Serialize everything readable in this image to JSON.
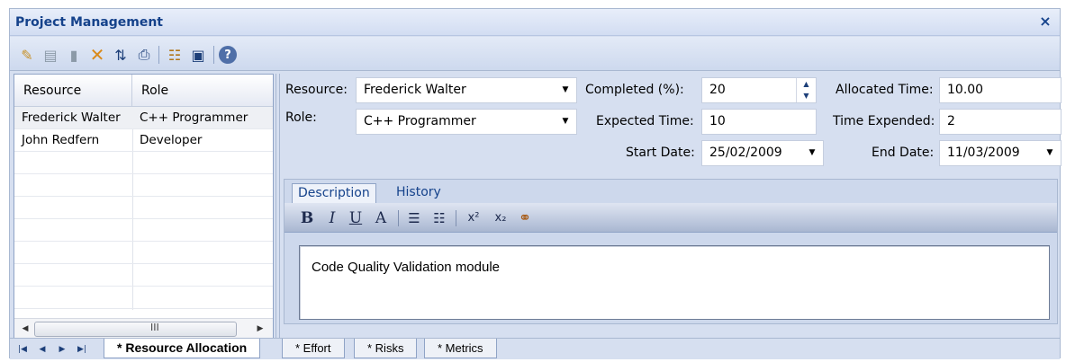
{
  "window": {
    "title": "Project Management",
    "close_glyph": "×"
  },
  "toolbar": {
    "buttons": [
      {
        "icon": "new-item-icon",
        "glyph": "✎"
      },
      {
        "icon": "save-icon",
        "glyph": "▤"
      },
      {
        "icon": "copy-icon",
        "glyph": "▮"
      },
      {
        "icon": "delete-icon",
        "glyph": "✕"
      },
      {
        "icon": "sort-az-icon",
        "glyph": "⇅"
      },
      {
        "icon": "print-icon",
        "glyph": "⎙"
      },
      {
        "icon": "hierarchy-icon",
        "glyph": "☷"
      },
      {
        "icon": "report-icon",
        "glyph": "▣"
      },
      {
        "icon": "help-icon",
        "glyph": "?"
      }
    ]
  },
  "grid": {
    "headers": {
      "resource": "Resource",
      "role": "Role"
    },
    "rows": [
      {
        "resource": "Frederick Walter",
        "role": "C++ Programmer"
      },
      {
        "resource": "John Redfern",
        "role": "Developer"
      }
    ],
    "scroll_grip": "III"
  },
  "form": {
    "resource_label": "Resource:",
    "resource_value": "Frederick Walter",
    "role_label": "Role:",
    "role_value": "C++ Programmer",
    "completed_label": "Completed (%):",
    "completed_value": "20",
    "expected_label": "Expected Time:",
    "expected_value": "10",
    "allocated_label": "Allocated Time:",
    "allocated_value": "10.00",
    "expended_label": "Time Expended:",
    "expended_value": "2",
    "start_label": "Start Date:",
    "start_value": "25/02/2009",
    "end_label": "End Date:",
    "end_value": "11/03/2009"
  },
  "description": {
    "tabs": [
      "Description",
      "History"
    ],
    "format_buttons": {
      "bold": "B",
      "italic": "I",
      "underline": "U",
      "font": "A",
      "bullets": "☰",
      "numbering": "☷",
      "superscript": "x²",
      "subscript": "x₂",
      "link": "⚭"
    },
    "text": "Code Quality Validation module"
  },
  "sheet_tabs": {
    "nav": {
      "first": "|◀",
      "prev": "◀",
      "next": "▶",
      "last": "▶|"
    },
    "tabs": [
      "* Resource Allocation",
      "* Effort",
      "* Risks",
      "* Metrics"
    ]
  },
  "colors": {
    "accent": "#15428b",
    "panel": "#d6dff0",
    "border": "#a9b8d1"
  }
}
